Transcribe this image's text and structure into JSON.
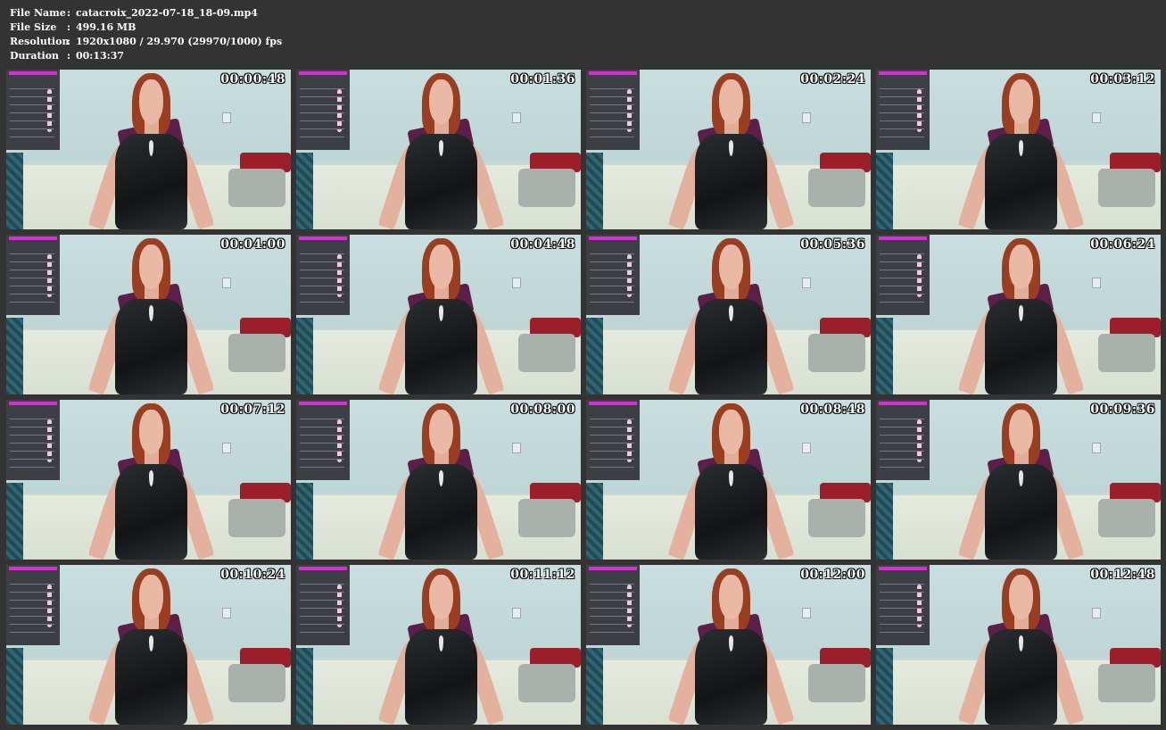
{
  "meta": [
    {
      "key": "File Name",
      "sep": ":",
      "value": "catacroix_2022-07-18_18-09.mp4"
    },
    {
      "key": "File Size",
      "sep": ":",
      "value": "499.16 MB"
    },
    {
      "key": "Resolution",
      "sep": ":",
      "value": "1920x1080 / 29.970 (29970/1000) fps"
    },
    {
      "key": "Duration",
      "sep": ":",
      "value": "00:13:37"
    }
  ],
  "thumbnails": [
    {
      "timestamp": "00:00:48"
    },
    {
      "timestamp": "00:01:36"
    },
    {
      "timestamp": "00:02:24"
    },
    {
      "timestamp": "00:03:12"
    },
    {
      "timestamp": "00:04:00"
    },
    {
      "timestamp": "00:04:48"
    },
    {
      "timestamp": "00:05:36"
    },
    {
      "timestamp": "00:06:24"
    },
    {
      "timestamp": "00:07:12"
    },
    {
      "timestamp": "00:08:00"
    },
    {
      "timestamp": "00:08:48"
    },
    {
      "timestamp": "00:09:36"
    },
    {
      "timestamp": "00:10:24"
    },
    {
      "timestamp": "00:11:12"
    },
    {
      "timestamp": "00:12:00"
    },
    {
      "timestamp": "00:12:48"
    }
  ],
  "colors": {
    "background": "#333333",
    "text": "#ffffff",
    "overlay_accent": "#d62fd6"
  }
}
